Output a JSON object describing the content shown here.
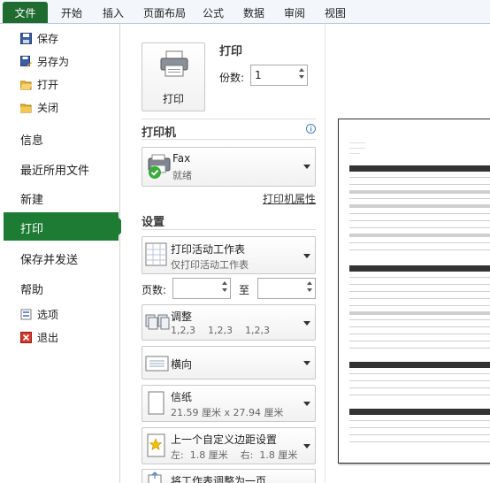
{
  "ribbon": {
    "file_tab": "文件",
    "tabs": [
      "开始",
      "插入",
      "页面布局",
      "公式",
      "数据",
      "审阅",
      "视图"
    ]
  },
  "nav": {
    "save": "保存",
    "save_as": "另存为",
    "open": "打开",
    "close": "关闭",
    "info": "信息",
    "recent": "最近所用文件",
    "new": "新建",
    "print": "打印",
    "save_send": "保存并发送",
    "help": "帮助",
    "options": "选项",
    "exit": "退出"
  },
  "print": {
    "heading": "打印",
    "button_label": "打印",
    "copies_label": "份数:",
    "copies_value": "1"
  },
  "printer": {
    "heading": "打印机",
    "name": "Fax",
    "status": "就绪",
    "properties_link": "打印机属性",
    "info_icon": "info-icon"
  },
  "settings": {
    "heading": "设置",
    "scope_title": "打印活动工作表",
    "scope_desc": "仅打印活动工作表",
    "pages_label": "页数:",
    "pages_to": "至",
    "pages_from_value": "",
    "pages_to_value": "",
    "collate_title": "调整",
    "collate_desc": "1,2,3    1,2,3    1,2,3",
    "orientation_title": "横向",
    "paper_title": "信纸",
    "paper_desc": "21.59 厘米 x 27.94 厘米",
    "margins_title": "上一个自定义边距设置",
    "margins_desc": "左:  1.8 厘米    右:  1.8 厘米",
    "scaling_title": "将工作表调整为一页"
  },
  "colors": {
    "file_tab": "#1f6b30",
    "nav_selected": "#1e7b34",
    "link": "#333333"
  }
}
